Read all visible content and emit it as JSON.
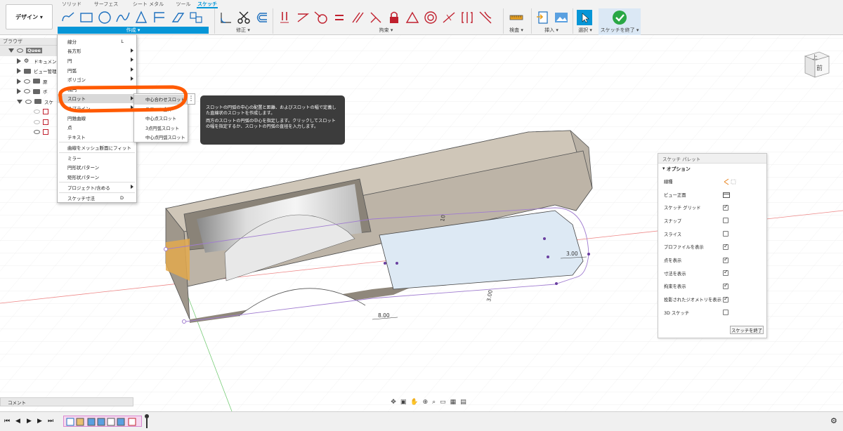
{
  "toolbar": {
    "design_button": "デザイン ▾",
    "tabs": [
      "ソリッド",
      "サーフェス",
      "シート メタル",
      "ツール",
      "スケッチ"
    ],
    "groups": {
      "create": "作成 ▾",
      "modify": "修正 ▾",
      "constraints": "拘束 ▾",
      "inspect": "検査 ▾",
      "insert": "挿入 ▾",
      "select": "選択 ▾",
      "finish": "スケッチを終了 ▾"
    }
  },
  "browser": {
    "header": "ブラウザ",
    "items": [
      "Quee",
      "ドキュメン",
      "ビュー管理",
      "原",
      "ボ",
      "スケ"
    ]
  },
  "create_menu": {
    "items": [
      {
        "label": "線分",
        "shortcut": "L"
      },
      {
        "label": "長方形",
        "arrow": true
      },
      {
        "label": "円",
        "arrow": true
      },
      {
        "label": "円弧",
        "arrow": true
      },
      {
        "label": "ポリゴン",
        "arrow": true
      },
      {
        "label": "楕円"
      },
      {
        "label": "スロット",
        "arrow": true
      },
      {
        "label": "スプライン",
        "arrow": true
      },
      {
        "label": "円錐曲線"
      },
      {
        "label": "点"
      },
      {
        "label": "テキスト"
      },
      {
        "label": "曲線をメッシュ断面にフィット"
      },
      {
        "label": "ミラー"
      },
      {
        "label": "円形状パターン"
      },
      {
        "label": "矩形状パターン"
      },
      {
        "label": "プロジェクト/含める",
        "arrow": true
      },
      {
        "label": "スケッチ寸法",
        "shortcut": "D"
      }
    ]
  },
  "slot_submenu": {
    "items": [
      "中心合わせスロット",
      "スロット全体",
      "中心点スロット",
      "3点円弧スロット",
      "中心点円弧スロット"
    ]
  },
  "tooltip": {
    "line1": "スロットの円弧の中心の配置と距離、およびスロットの幅で定義した直線状のスロットを作成します。",
    "line2": "両方のスロットの円弧の中心を指定します。クリックしてスロットの幅を指定するか、スロットの円弧の直径を入力します。"
  },
  "viewcube": {
    "top": "上",
    "front": "前"
  },
  "dimensions": [
    "10",
    "3.00",
    "8.00",
    "3.00"
  ],
  "palette": {
    "title": "スケッチ パレット",
    "section": "オプション",
    "rows": [
      {
        "label": "線種"
      },
      {
        "label": "ビュー正面"
      },
      {
        "label": "スケッチ グリッド",
        "checked": true
      },
      {
        "label": "スナップ",
        "checked": false
      },
      {
        "label": "スライス",
        "checked": false
      },
      {
        "label": "プロファイルを表示",
        "checked": true
      },
      {
        "label": "点を表示",
        "checked": true
      },
      {
        "label": "寸法を表示",
        "checked": true
      },
      {
        "label": "拘束を表示",
        "checked": true
      },
      {
        "label": "投影されたジオメトリを表示",
        "checked": true
      },
      {
        "label": "3D スケッチ",
        "checked": false
      }
    ],
    "finish_button": "スケッチを終了"
  },
  "comment_bar": "コメント",
  "colors": {
    "accent": "#0696d7",
    "highlight_ring": "#ff5a00",
    "model": "#b8b0a4"
  }
}
